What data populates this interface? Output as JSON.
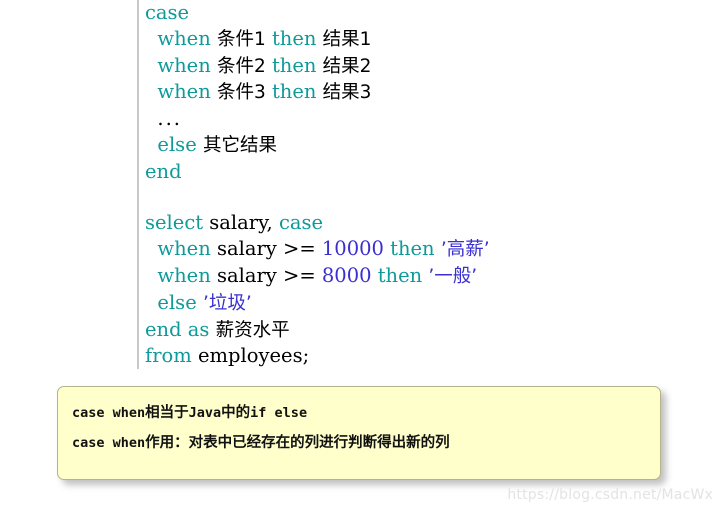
{
  "code_block": {
    "gutter_color": "#c9c9c9",
    "keyword_color": "#0f9a9a",
    "literal_color": "#3a2fd0",
    "text_color": "#000000",
    "lines": [
      {
        "id": "line-1",
        "indent": 0,
        "tokens": [
          {
            "t": "case",
            "k": "kw"
          }
        ]
      },
      {
        "id": "line-2",
        "indent": 1,
        "tokens": [
          {
            "t": "when",
            "k": "kw"
          },
          {
            "t": " ",
            "k": "plain"
          },
          {
            "t": "条件1",
            "k": "cjk"
          },
          {
            "t": " ",
            "k": "plain"
          },
          {
            "t": "then",
            "k": "kw"
          },
          {
            "t": " ",
            "k": "plain"
          },
          {
            "t": "结果1",
            "k": "cjk"
          }
        ]
      },
      {
        "id": "line-3",
        "indent": 1,
        "tokens": [
          {
            "t": "when",
            "k": "kw"
          },
          {
            "t": " ",
            "k": "plain"
          },
          {
            "t": "条件2",
            "k": "cjk"
          },
          {
            "t": " ",
            "k": "plain"
          },
          {
            "t": "then",
            "k": "kw"
          },
          {
            "t": " ",
            "k": "plain"
          },
          {
            "t": "结果2",
            "k": "cjk"
          }
        ]
      },
      {
        "id": "line-4",
        "indent": 1,
        "tokens": [
          {
            "t": "when",
            "k": "kw"
          },
          {
            "t": " ",
            "k": "plain"
          },
          {
            "t": "条件3",
            "k": "cjk"
          },
          {
            "t": " ",
            "k": "plain"
          },
          {
            "t": "then",
            "k": "kw"
          },
          {
            "t": " ",
            "k": "plain"
          },
          {
            "t": "结果3",
            "k": "cjk"
          }
        ]
      },
      {
        "id": "line-5",
        "indent": 1,
        "tokens": [
          {
            "t": "...",
            "k": "dots"
          }
        ]
      },
      {
        "id": "line-6",
        "indent": 1,
        "tokens": [
          {
            "t": "else",
            "k": "kw"
          },
          {
            "t": " ",
            "k": "plain"
          },
          {
            "t": "其它结果",
            "k": "cjk"
          }
        ]
      },
      {
        "id": "line-7",
        "indent": 0,
        "tokens": [
          {
            "t": "end",
            "k": "kw"
          }
        ]
      },
      {
        "id": "line-8",
        "indent": 0,
        "tokens": []
      },
      {
        "id": "line-9",
        "indent": 0,
        "tokens": [
          {
            "t": "select",
            "k": "kw"
          },
          {
            "t": " salary, ",
            "k": "plain"
          },
          {
            "t": "case",
            "k": "kw"
          }
        ]
      },
      {
        "id": "line-10",
        "indent": 1,
        "tokens": [
          {
            "t": "when",
            "k": "kw"
          },
          {
            "t": " salary >= ",
            "k": "plain"
          },
          {
            "t": "10000",
            "k": "num"
          },
          {
            "t": " ",
            "k": "plain"
          },
          {
            "t": "then",
            "k": "kw"
          },
          {
            "t": " ",
            "k": "plain"
          },
          {
            "t": "’高薪’",
            "k": "cjkstr"
          }
        ]
      },
      {
        "id": "line-11",
        "indent": 1,
        "tokens": [
          {
            "t": "when",
            "k": "kw"
          },
          {
            "t": " salary >= ",
            "k": "plain"
          },
          {
            "t": "8000",
            "k": "num"
          },
          {
            "t": " ",
            "k": "plain"
          },
          {
            "t": "then",
            "k": "kw"
          },
          {
            "t": " ",
            "k": "plain"
          },
          {
            "t": "’一般’",
            "k": "cjkstr"
          }
        ]
      },
      {
        "id": "line-12",
        "indent": 1,
        "tokens": [
          {
            "t": "else",
            "k": "kw"
          },
          {
            "t": " ",
            "k": "plain"
          },
          {
            "t": "’垃圾’",
            "k": "cjkstr"
          }
        ]
      },
      {
        "id": "line-13",
        "indent": 0,
        "tokens": [
          {
            "t": "end",
            "k": "kw"
          },
          {
            "t": " ",
            "k": "plain"
          },
          {
            "t": "as",
            "k": "kw"
          },
          {
            "t": " ",
            "k": "plain"
          },
          {
            "t": "薪资水平",
            "k": "cjk"
          }
        ]
      },
      {
        "id": "line-14",
        "indent": 0,
        "tokens": [
          {
            "t": "from",
            "k": "kw"
          },
          {
            "t": " employees;",
            "k": "plain"
          }
        ]
      }
    ]
  },
  "note": {
    "background_color": "#ffffcc",
    "border_color": "#b4b48a",
    "line_1": [
      {
        "t": "case when",
        "k": "ascii"
      },
      {
        "t": "相当于",
        "k": "han"
      },
      {
        "t": "Java",
        "k": "ascii"
      },
      {
        "t": "中的",
        "k": "han"
      },
      {
        "t": "if else",
        "k": "ascii"
      }
    ],
    "line_2": [
      {
        "t": "case when",
        "k": "ascii"
      },
      {
        "t": "作用：对表中已经存在的列进行判断得出新的列",
        "k": "han"
      }
    ]
  },
  "watermark": {
    "text": "https://blog.csdn.net/MacWx",
    "color": "#e3e3e3"
  }
}
